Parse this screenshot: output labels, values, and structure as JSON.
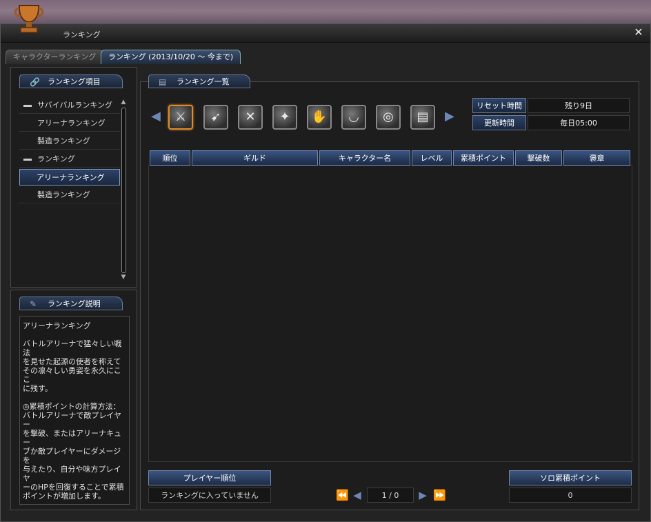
{
  "window": {
    "title": "ランキング",
    "close": "✕"
  },
  "tabs": [
    {
      "label": "キャラクターランキング",
      "active": false
    },
    {
      "label": "ランキング (2013/10/20 ～ 今まで)",
      "active": true
    }
  ],
  "left_panel": {
    "header": "ランキング項目",
    "items": [
      {
        "label": "サバイバルランキング",
        "type": "group"
      },
      {
        "label": "アリーナランキング",
        "type": "child"
      },
      {
        "label": "製造ランキング",
        "type": "child"
      },
      {
        "label": "ランキング",
        "type": "group"
      },
      {
        "label": "アリーナランキング",
        "type": "child",
        "selected": true
      },
      {
        "label": "製造ランキング",
        "type": "child"
      }
    ]
  },
  "desc_panel": {
    "header": "ランキング説明",
    "paragraphs": [
      "アリーナランキング",
      "バトルアリーナで猛々しい戦法\nを見せた起源の使者を称えて\nその凛々しい勇姿を永久にここ\nに残す。",
      "◎累積ポイントの計算方法：\nバトルアリーナで敵プレイヤー\nを撃破、またはアリーナキュー\nブか敵プレイヤーにダメージを\n与えたり、自分や味方プレイヤ\nーのHPを回復することで累積\nポイントが増加します。"
    ]
  },
  "main_panel": {
    "header": "ランキング一覧",
    "categories": [
      {
        "icon": "sword-icon",
        "glyph": "⚔",
        "selected": true
      },
      {
        "icon": "bow-icon",
        "glyph": "➹",
        "selected": false
      },
      {
        "icon": "crossed-weapons-icon",
        "glyph": "✕",
        "selected": false
      },
      {
        "icon": "gun-icon",
        "glyph": "✦",
        "selected": false
      },
      {
        "icon": "gauntlet-icon",
        "glyph": "✋",
        "selected": false
      },
      {
        "icon": "shield-icon",
        "glyph": "◡",
        "selected": false
      },
      {
        "icon": "orb-staff-icon",
        "glyph": "◎",
        "selected": false
      },
      {
        "icon": "book-icon",
        "glyph": "▤",
        "selected": false
      }
    ],
    "reset_label": "リセット時間",
    "reset_value": "残り9日",
    "update_label": "更新時間",
    "update_value": "毎日05:00",
    "columns": [
      "順位",
      "ギルド",
      "キャラクター名",
      "レベル",
      "累積ポイント",
      "撃破数",
      "褒章"
    ]
  },
  "footer": {
    "player_rank_label": "プレイヤー順位",
    "player_rank_value": "ランキングに入っていません",
    "page": "1 / 0",
    "solo_points_label": "ソロ累積ポイント",
    "solo_points_value": "0"
  }
}
